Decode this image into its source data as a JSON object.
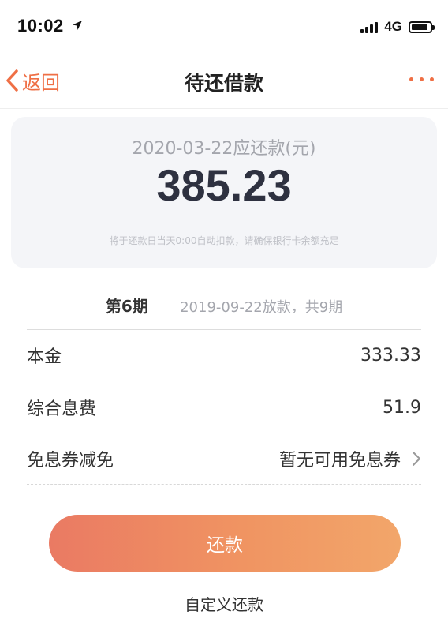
{
  "status_bar": {
    "time": "10:02",
    "network": "4G"
  },
  "nav": {
    "back_label": "返回",
    "title": "待还借款"
  },
  "summary": {
    "due_label": "2020-03-22应还款(元)",
    "amount": "385.23",
    "note": "将于还款日当天0:00自动扣款，请确保银行卡余额充足"
  },
  "period": {
    "number": "第6期",
    "info": "2019-09-22放款，共9期"
  },
  "details": [
    {
      "label": "本金",
      "value": "333.33"
    },
    {
      "label": "综合息费",
      "value": "51.9"
    },
    {
      "label": "免息券减免",
      "value": "暂无可用免息券"
    }
  ],
  "actions": {
    "pay_label": "还款",
    "custom_label": "自定义还款"
  },
  "colors": {
    "accent": "#ef6f45",
    "button_gradient_start": "#ea7a63",
    "button_gradient_end": "#f2a66a"
  }
}
